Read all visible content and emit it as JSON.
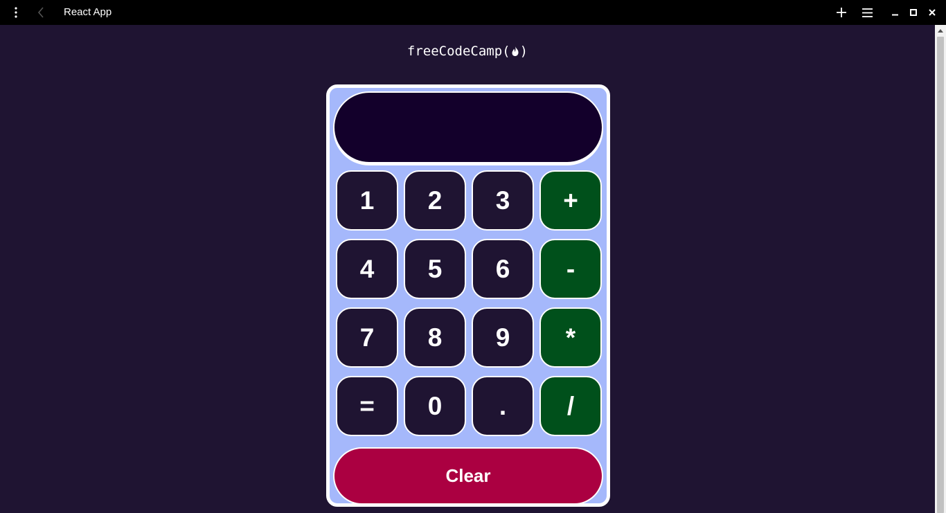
{
  "window": {
    "title": "React App",
    "icons": [
      "more-vertical-icon",
      "back-arrow-icon",
      "plus-icon",
      "menu-icon",
      "minimize-icon",
      "maximize-icon",
      "close-icon"
    ]
  },
  "header": {
    "logo_prefix": "freeCodeCamp(",
    "logo_suffix": ")"
  },
  "calculator": {
    "display_value": "",
    "rows": [
      [
        {
          "label": "1",
          "type": "digit"
        },
        {
          "label": "2",
          "type": "digit"
        },
        {
          "label": "3",
          "type": "digit"
        },
        {
          "label": "+",
          "type": "op"
        }
      ],
      [
        {
          "label": "4",
          "type": "digit"
        },
        {
          "label": "5",
          "type": "digit"
        },
        {
          "label": "6",
          "type": "digit"
        },
        {
          "label": "-",
          "type": "op"
        }
      ],
      [
        {
          "label": "7",
          "type": "digit"
        },
        {
          "label": "8",
          "type": "digit"
        },
        {
          "label": "9",
          "type": "digit"
        },
        {
          "label": "*",
          "type": "op"
        }
      ],
      [
        {
          "label": "=",
          "type": "digit"
        },
        {
          "label": "0",
          "type": "digit"
        },
        {
          "label": ".",
          "type": "digit"
        },
        {
          "label": "/",
          "type": "op"
        }
      ]
    ],
    "clear_label": "Clear"
  },
  "colors": {
    "page_background": "#1f1432",
    "calculator_background": "#a5b8fb",
    "display_background": "#13002b",
    "digit_key": "#1f1432",
    "operator_key": "#00501b",
    "clear_button": "#ab0041"
  }
}
